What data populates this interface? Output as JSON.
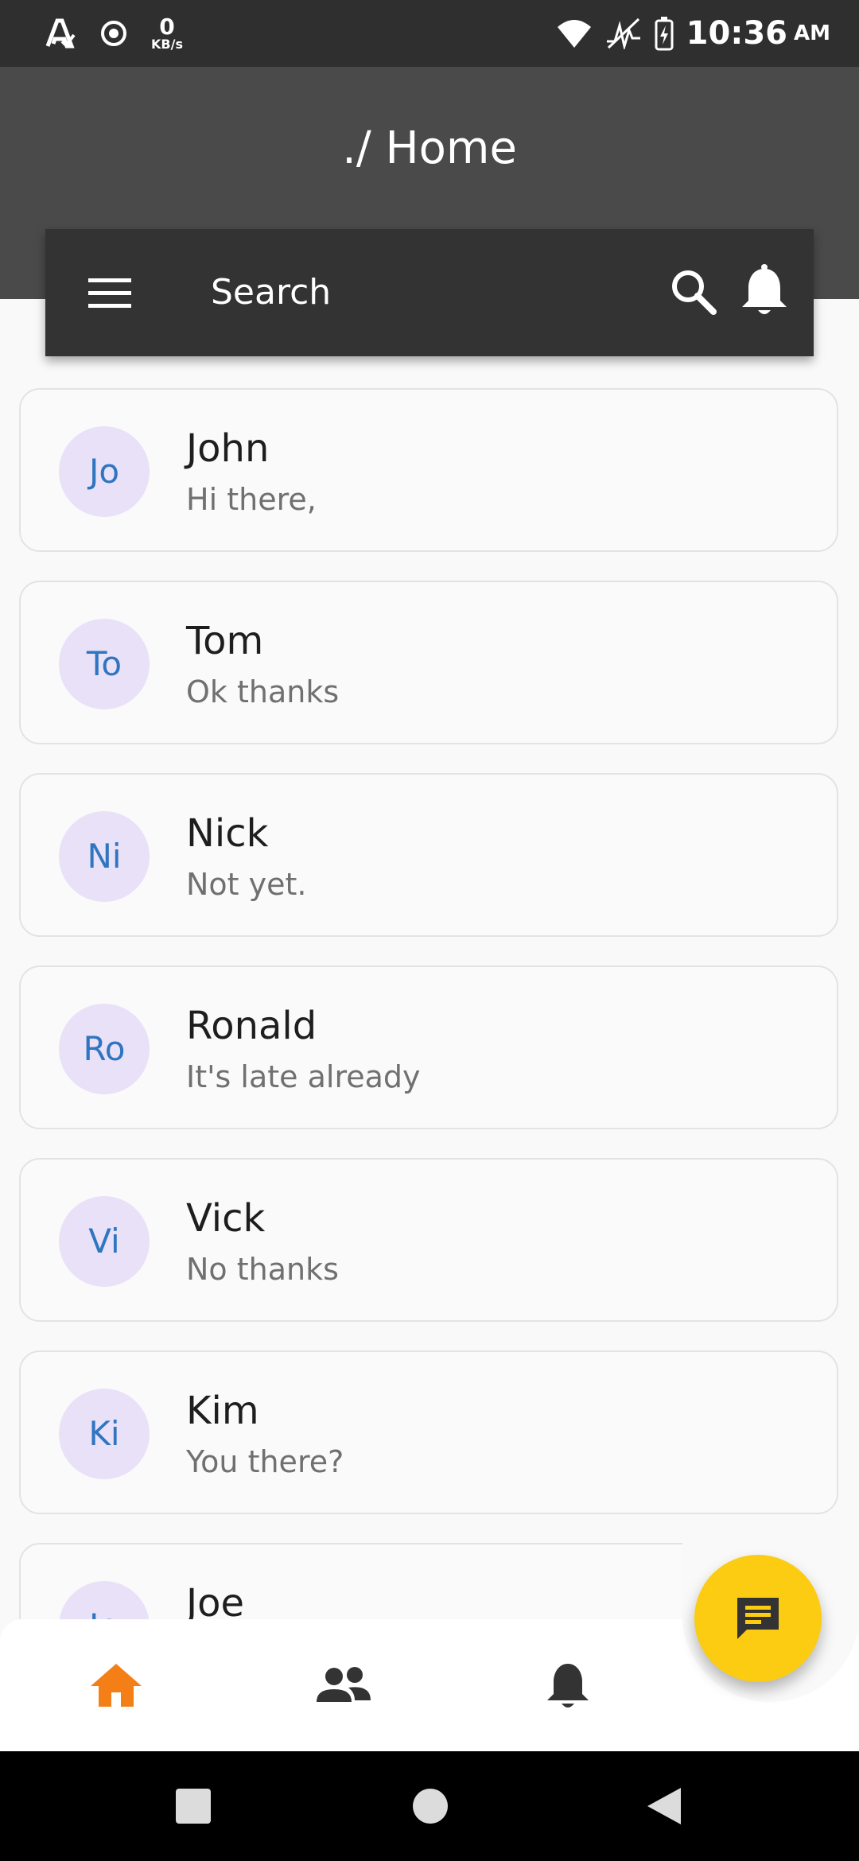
{
  "status_bar": {
    "net_speed_value": "0",
    "net_speed_unit": "KB/s",
    "time": "10:36",
    "ampm": "AM",
    "icons": [
      "autofill-icon",
      "record-icon",
      "wifi-icon",
      "signal-icon",
      "battery-charging-icon"
    ]
  },
  "header": {
    "title": "./ Home",
    "search_placeholder": "Search",
    "background_color": "#4a4a4a",
    "search_bar_color": "#333333"
  },
  "chats": [
    {
      "initials": "Jo",
      "name": "John",
      "message": "Hi there,"
    },
    {
      "initials": "To",
      "name": "Tom",
      "message": "Ok thanks"
    },
    {
      "initials": "Ni",
      "name": "Nick",
      "message": "Not yet."
    },
    {
      "initials": "Ro",
      "name": "Ronald",
      "message": "It's late already"
    },
    {
      "initials": "Vi",
      "name": "Vick",
      "message": "No thanks"
    },
    {
      "initials": "Ki",
      "name": "Kim",
      "message": "You there?"
    },
    {
      "initials": "Jo",
      "name": "Joe",
      "message": ""
    }
  ],
  "bottom_nav": {
    "items": [
      "home-icon",
      "people-icon",
      "notifications-icon"
    ],
    "active_color": "#f57f17",
    "inactive_color": "#333333"
  },
  "fab": {
    "icon": "chat-icon",
    "color": "#fccc12"
  },
  "avatar_colors": {
    "background": "#e9e1f8",
    "text": "#3075c0"
  }
}
